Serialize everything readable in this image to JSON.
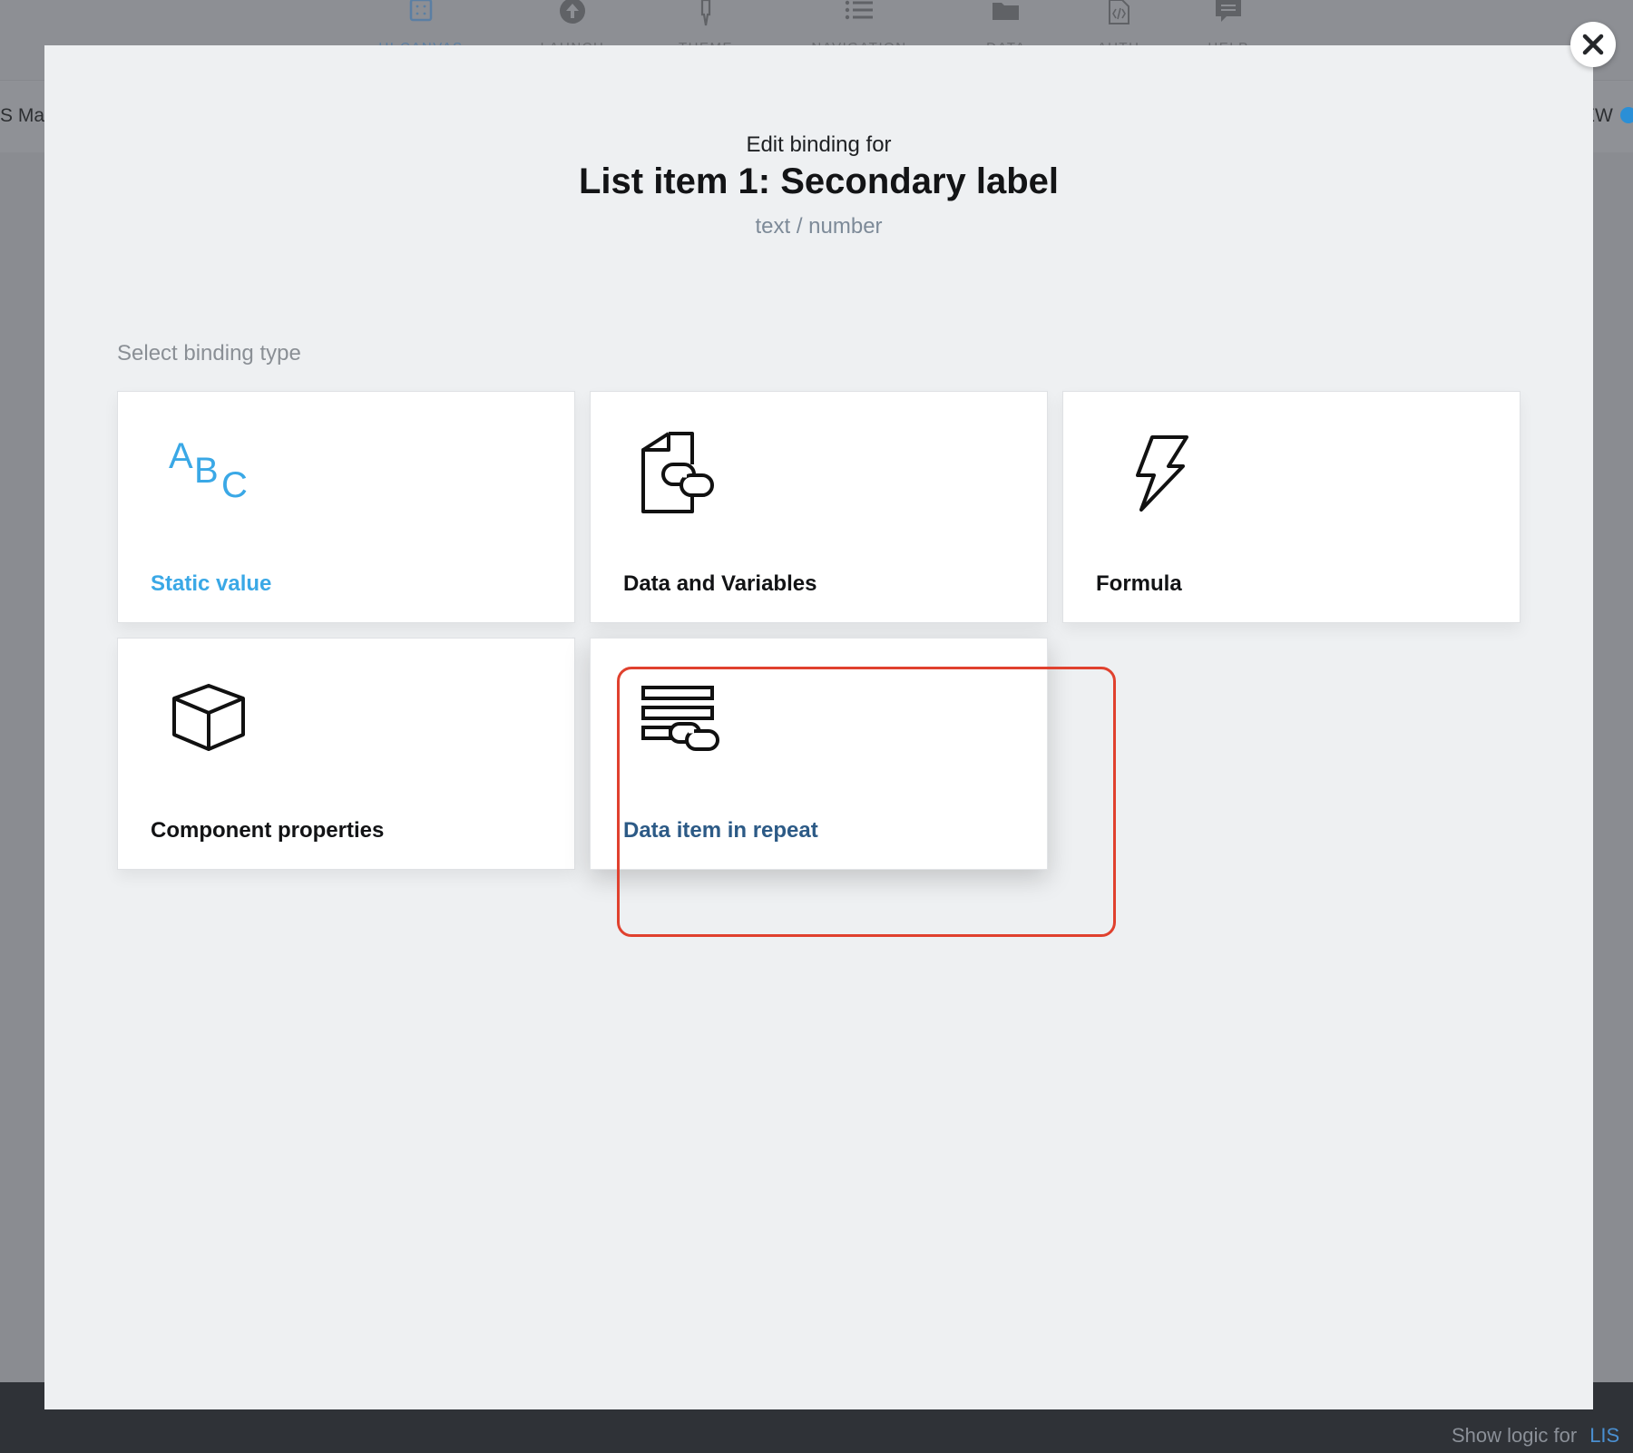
{
  "app": {
    "nav_items": [
      {
        "label": "UI CANVAS",
        "icon": "canvas-icon"
      },
      {
        "label": "LAUNCH",
        "icon": "launch-icon"
      },
      {
        "label": "THEME",
        "icon": "theme-icon"
      },
      {
        "label": "NAVIGATION",
        "icon": "navigation-icon"
      },
      {
        "label": "DATA",
        "icon": "folder-icon"
      },
      {
        "label": "AUTH",
        "icon": "auth-icon"
      },
      {
        "label": "HELP",
        "icon": "help-icon"
      }
    ],
    "subbar_left": "S Ma",
    "subbar_right": "EW",
    "bottom_text": "Show logic for",
    "bottom_link": "LIS",
    "accent_color": "#2b8fd6"
  },
  "modal": {
    "subtitle": "Edit binding for",
    "title": "List item 1: Secondary label",
    "value_type": "text / number",
    "section_label": "Select binding type",
    "close_icon": "close-icon",
    "highlight_color": "#e0412e",
    "cards": [
      {
        "label": "Static value",
        "icon": "abc-icon",
        "color": "#3aa8e6"
      },
      {
        "label": "Data and Variables",
        "icon": "document-link-icon",
        "color": "#121315"
      },
      {
        "label": "Formula",
        "icon": "lightning-icon",
        "color": "#121315"
      },
      {
        "label": "Component properties",
        "icon": "cube-icon",
        "color": "#121315"
      },
      {
        "label": "Data item in repeat",
        "icon": "list-link-icon",
        "color": "#2c5a86",
        "highlighted": true
      }
    ]
  }
}
